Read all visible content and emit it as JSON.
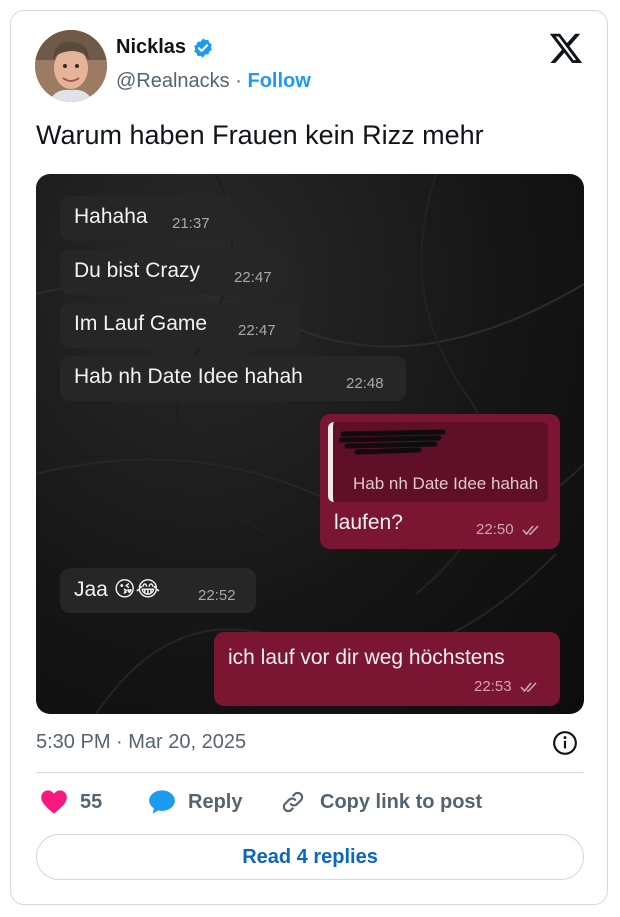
{
  "author": {
    "name": "Nicklas",
    "handle": "@Realnacks",
    "separator": "·",
    "follow_label": "Follow"
  },
  "tweet": {
    "text": "Warum haben Frauen kein Rizz mehr",
    "timestamp": "5:30 PM · Mar 20, 2025"
  },
  "chat": {
    "messages": [
      {
        "direction": "incoming",
        "text": "Hahaha",
        "time": "21:37"
      },
      {
        "direction": "incoming",
        "text": "Du bist Crazy",
        "time": "22:47"
      },
      {
        "direction": "incoming",
        "text": "Im Lauf Game",
        "time": "22:47"
      },
      {
        "direction": "incoming",
        "text": "Hab nh Date Idee hahah",
        "time": "22:48"
      },
      {
        "direction": "outgoing",
        "quoted_text": "Hab nh Date Idee hahah",
        "text": "laufen?",
        "time": "22:50"
      },
      {
        "direction": "incoming",
        "text": "Jaa 😘😂",
        "time": "22:52"
      },
      {
        "direction": "outgoing",
        "text": "ich lauf vor dir weg höchstens",
        "time": "22:53"
      }
    ]
  },
  "actions": {
    "like_count": "55",
    "reply_label": "Reply",
    "copy_link_label": "Copy link to post",
    "read_replies_label": "Read 4 replies"
  },
  "icons": {
    "verified": "verified-badge-icon",
    "x_logo": "x-logo-icon",
    "info": "info-icon",
    "like": "heart-icon",
    "reply": "speech-bubble-icon",
    "copy_link": "link-icon",
    "read_ticks": "double-check-icon"
  },
  "colors": {
    "accent": "#1d9bf0",
    "like": "#f91880",
    "outgoing_bubble": "#7a1532",
    "incoming_bubble": "#262626"
  }
}
